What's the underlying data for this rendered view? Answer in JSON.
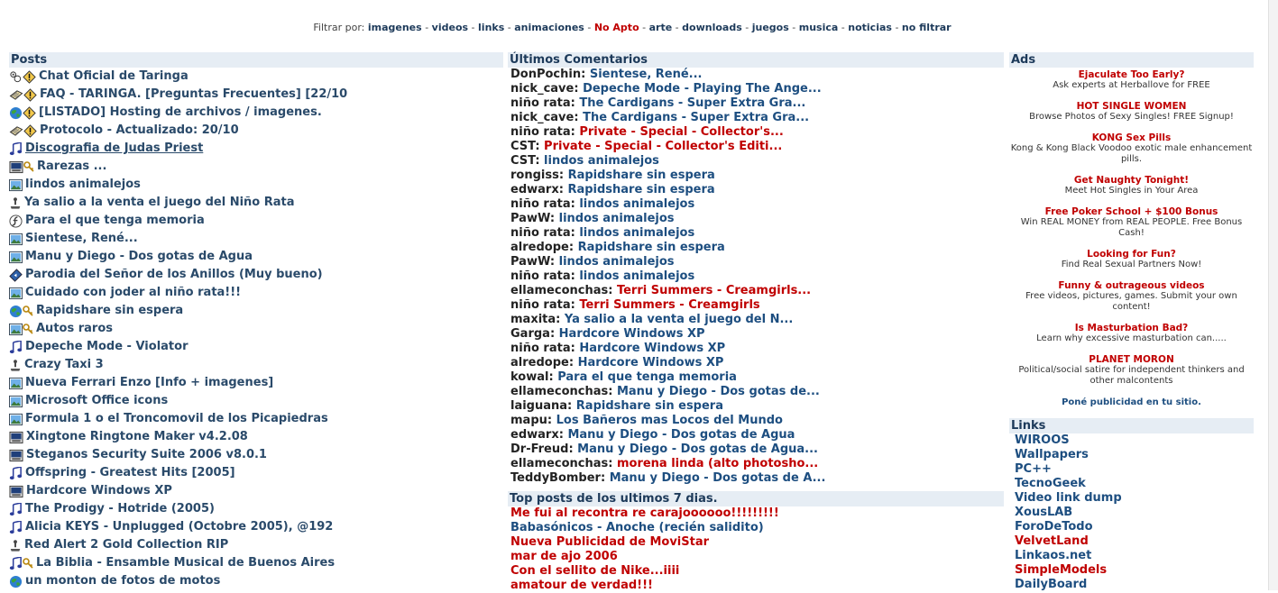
{
  "filter": {
    "label": "Filtrar por:",
    "items": [
      {
        "label": "imagenes",
        "red": false
      },
      {
        "label": "videos",
        "red": false
      },
      {
        "label": "links",
        "red": false
      },
      {
        "label": "animaciones",
        "red": false
      },
      {
        "label": "No Apto",
        "red": true
      },
      {
        "label": "arte",
        "red": false
      },
      {
        "label": "downloads",
        "red": false
      },
      {
        "label": "juegos",
        "red": false
      },
      {
        "label": "musica",
        "red": false
      },
      {
        "label": "noticias",
        "red": false
      },
      {
        "label": "no filtrar",
        "red": false
      }
    ],
    "separator": "-"
  },
  "posts": {
    "header": "Posts",
    "items": [
      {
        "label": "Chat Oficial de Taringa",
        "icons": [
          "chat-icon",
          "sticky-icon"
        ],
        "underline": false
      },
      {
        "label": "FAQ - TARINGA. [Preguntas Frecuentes] [22/10",
        "icons": [
          "notes-icon",
          "sticky-icon"
        ],
        "underline": false
      },
      {
        "label": "[LISTADO] Hosting de archivos / imagenes.",
        "icons": [
          "globe-icon",
          "sticky-icon"
        ],
        "underline": false
      },
      {
        "label": "Protocolo - Actualizado: 20/10",
        "icons": [
          "notes-icon",
          "sticky-icon"
        ],
        "underline": false
      },
      {
        "label": "Discografia de Judas Priest",
        "icons": [
          "music-icon"
        ],
        "underline": true
      },
      {
        "label": "Rarezas ...",
        "icons": [
          "software-icon",
          "key-icon"
        ],
        "underline": false
      },
      {
        "label": "lindos animalejos",
        "icons": [
          "image-icon"
        ],
        "underline": false
      },
      {
        "label": "Ya salio a la venta el juego del Niño Rata",
        "icons": [
          "joystick-icon"
        ],
        "underline": false
      },
      {
        "label": "Para el que tenga memoria",
        "icons": [
          "flash-icon"
        ],
        "underline": false
      },
      {
        "label": "Sientese, René...",
        "icons": [
          "image-icon"
        ],
        "underline": false
      },
      {
        "label": "Manu y Diego - Dos gotas de Agua",
        "icons": [
          "image-icon"
        ],
        "underline": false
      },
      {
        "label": "Parodia del Señor de los Anillos (Muy bueno)",
        "icons": [
          "video-icon"
        ],
        "underline": false
      },
      {
        "label": "Cuidado con joder al niño rata!!!",
        "icons": [
          "image-icon"
        ],
        "underline": false
      },
      {
        "label": "Rapidshare sin espera",
        "icons": [
          "globe-icon",
          "key-icon"
        ],
        "underline": false
      },
      {
        "label": "Autos raros",
        "icons": [
          "image-icon",
          "key-icon"
        ],
        "underline": false
      },
      {
        "label": "Depeche Mode - Violator",
        "icons": [
          "music-icon"
        ],
        "underline": false
      },
      {
        "label": "Crazy Taxi 3",
        "icons": [
          "joystick-icon"
        ],
        "underline": false
      },
      {
        "label": "Nueva Ferrari Enzo [Info + imagenes]",
        "icons": [
          "image-icon"
        ],
        "underline": false
      },
      {
        "label": "Microsoft Office icons",
        "icons": [
          "image-icon"
        ],
        "underline": false
      },
      {
        "label": "Formula 1 o el Troncomovil de los Picapiedras",
        "icons": [
          "image-icon"
        ],
        "underline": false
      },
      {
        "label": "Xingtone Ringtone Maker v4.2.08",
        "icons": [
          "software-icon"
        ],
        "underline": false
      },
      {
        "label": "Steganos Security Suite 2006 v8.0.1",
        "icons": [
          "software-icon"
        ],
        "underline": false
      },
      {
        "label": "Offspring - Greatest Hits [2005]",
        "icons": [
          "music-icon"
        ],
        "underline": false
      },
      {
        "label": "Hardcore Windows XP",
        "icons": [
          "software-icon"
        ],
        "underline": false
      },
      {
        "label": "The Prodigy - Hotride (2005)",
        "icons": [
          "music-icon"
        ],
        "underline": false
      },
      {
        "label": "Alicia KEYS - Unplugged (Octobre 2005), @192",
        "icons": [
          "music-icon"
        ],
        "underline": false
      },
      {
        "label": "Red Alert 2 Gold Collection RIP",
        "icons": [
          "joystick-icon"
        ],
        "underline": false
      },
      {
        "label": "La Biblia - Ensamble Musical de Buenos Aires",
        "icons": [
          "music-icon",
          "key-icon"
        ],
        "underline": false
      },
      {
        "label": "un monton de fotos de motos",
        "icons": [
          "globe-icon"
        ],
        "underline": false
      }
    ]
  },
  "comments": {
    "header": "Últimos Comentarios",
    "items": [
      {
        "user": "DonPochin",
        "title": "Sientese, René...",
        "red": false
      },
      {
        "user": "nick_cave",
        "title": "Depeche Mode - Playing The Ange...",
        "red": false
      },
      {
        "user": "niño rata",
        "title": "The Cardigans - Super Extra Gra...",
        "red": false
      },
      {
        "user": "nick_cave",
        "title": "The Cardigans - Super Extra Gra...",
        "red": false
      },
      {
        "user": "niño rata",
        "title": "Private - Special - Collector's...",
        "red": true
      },
      {
        "user": "CST",
        "title": "Private - Special - Collector's Editi...",
        "red": true
      },
      {
        "user": "CST",
        "title": "lindos animalejos",
        "red": false
      },
      {
        "user": "rongiss",
        "title": "Rapidshare sin espera",
        "red": false
      },
      {
        "user": "edwarx",
        "title": "Rapidshare sin espera",
        "red": false
      },
      {
        "user": "niño rata",
        "title": "lindos animalejos",
        "red": false
      },
      {
        "user": "PawW",
        "title": "lindos animalejos",
        "red": false
      },
      {
        "user": "niño rata",
        "title": "lindos animalejos",
        "red": false
      },
      {
        "user": "alredope",
        "title": "Rapidshare sin espera",
        "red": false
      },
      {
        "user": "PawW",
        "title": "lindos animalejos",
        "red": false
      },
      {
        "user": "niño rata",
        "title": "lindos animalejos",
        "red": false
      },
      {
        "user": "ellameconchas",
        "title": "Terri Summers - Creamgirls...",
        "red": true
      },
      {
        "user": "niño rata",
        "title": "Terri Summers - Creamgirls",
        "red": true
      },
      {
        "user": "maxita",
        "title": "Ya salio a la venta el juego del N...",
        "red": false
      },
      {
        "user": "Garga",
        "title": "Hardcore Windows XP",
        "red": false
      },
      {
        "user": "niño rata",
        "title": "Hardcore Windows XP",
        "red": false
      },
      {
        "user": "alredope",
        "title": "Hardcore Windows XP",
        "red": false
      },
      {
        "user": "kowal",
        "title": "Para el que tenga memoria",
        "red": false
      },
      {
        "user": "ellameconchas",
        "title": "Manu y Diego - Dos gotas de...",
        "red": false
      },
      {
        "user": "laiguana",
        "title": "Rapidshare sin espera",
        "red": false
      },
      {
        "user": "mapu",
        "title": "Los Bañeros mas Locos del Mundo",
        "red": false
      },
      {
        "user": "edwarx",
        "title": "Manu y Diego - Dos gotas de Agua",
        "red": false
      },
      {
        "user": "Dr-Freud",
        "title": "Manu y Diego - Dos gotas de Agua...",
        "red": false
      },
      {
        "user": "ellameconchas",
        "title": "morena linda (alto photosho...",
        "red": true
      },
      {
        "user": "TeddyBomber",
        "title": "Manu y Diego - Dos gotas de A...",
        "red": false
      }
    ]
  },
  "top_posts": {
    "header": "Top posts de los ultimos 7 dias.",
    "items": [
      {
        "title": "Me fui al recontra re carajoooooo!!!!!!!!!",
        "red": true
      },
      {
        "title": "Babasónicos - Anoche (recién salidito)",
        "red": false
      },
      {
        "title": "Nueva Publicidad de MoviStar",
        "red": true
      },
      {
        "title": "mar de ajo 2006",
        "red": true
      },
      {
        "title": "Con el sellito de Nike...iiii",
        "red": true
      },
      {
        "title": "amatour de verdad!!!",
        "red": true
      }
    ]
  },
  "ads": {
    "header": "Ads",
    "items": [
      {
        "title": "Ejaculate Too Early?",
        "desc": "Ask experts at Herballove for FREE"
      },
      {
        "title": "HOT SINGLE WOMEN",
        "desc": "Browse Photos of Sexy Singles! FREE Signup!"
      },
      {
        "title": "KONG Sex Pills",
        "desc": "Kong & Kong Black Voodoo exotic male enhancement pills."
      },
      {
        "title": "Get Naughty Tonight!",
        "desc": "Meet Hot Singles in Your Area"
      },
      {
        "title": "Free Poker School + $100 Bonus",
        "desc": "Win REAL MONEY from REAL PEOPLE. Free Bonus Cash!"
      },
      {
        "title": "Looking for Fun?",
        "desc": "Find Real Sexual Partners Now!"
      },
      {
        "title": "Funny & outrageous videos",
        "desc": "Free videos, pictures, games. Submit your own content!"
      },
      {
        "title": "Is Masturbation Bad?",
        "desc": "Learn why excessive masturbation can....."
      },
      {
        "title": "PLANET MORON",
        "desc": "Political/social satire for independent thinkers and other malcontents"
      }
    ],
    "promo": "Poné publicidad en tu sitio."
  },
  "links": {
    "header": "Links",
    "items": [
      {
        "label": "WIROOS",
        "red": false
      },
      {
        "label": "Wallpapers",
        "red": false
      },
      {
        "label": "PC++",
        "red": false
      },
      {
        "label": "TecnoGeek",
        "red": false
      },
      {
        "label": "Video link dump",
        "red": false
      },
      {
        "label": "XousLAB",
        "red": false
      },
      {
        "label": "ForoDeTodo",
        "red": false
      },
      {
        "label": "VelvetLand",
        "red": true
      },
      {
        "label": "Linkaos.net",
        "red": false
      },
      {
        "label": "SimpleModels",
        "red": true
      },
      {
        "label": "DailyBoard",
        "red": false
      }
    ]
  }
}
